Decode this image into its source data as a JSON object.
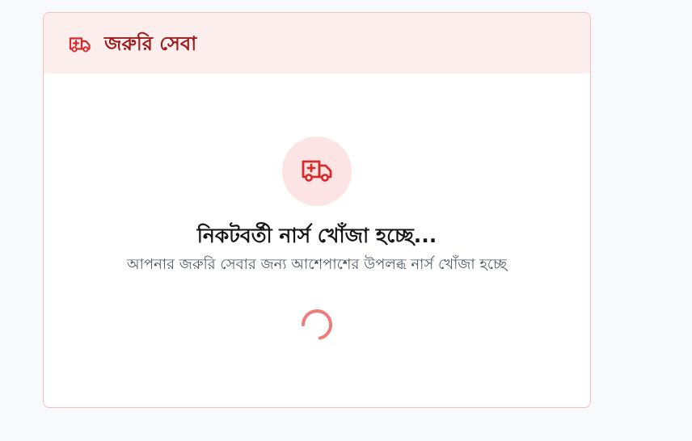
{
  "card": {
    "title": "জরুরি সেবা",
    "header_icon": "ambulance-icon"
  },
  "status": {
    "icon": "ambulance-icon",
    "title": "নিকটবর্তী নার্স খোঁজা হচ্ছে...",
    "subtitle": "আপনার জরুরি সেবার জন্য আশেপাশের উপলব্ধ নার্স খোঁজা হচ্ছে",
    "spinner": "loading-spinner-icon"
  },
  "colors": {
    "accent": "#d82a2a",
    "title_red": "#9d1b1b",
    "header_bg": "#fdeeee",
    "circle_bg": "#fde4e4",
    "spinner": "#f07b7b"
  }
}
